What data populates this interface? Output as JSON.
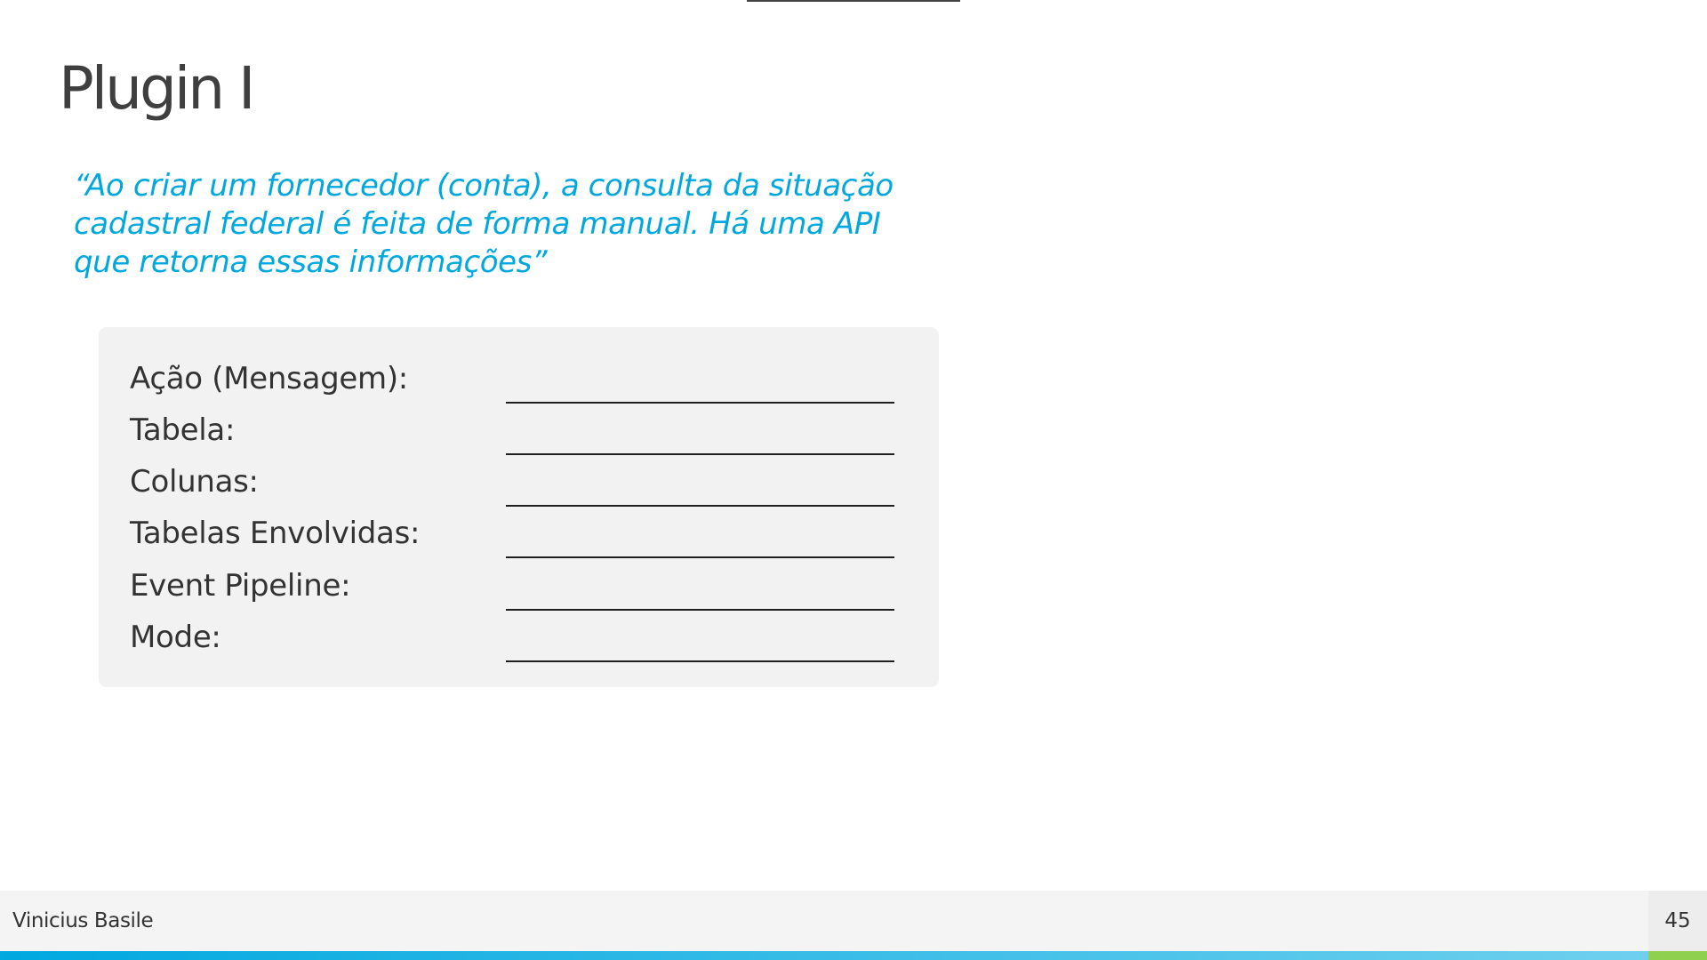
{
  "slide": {
    "title": "Plugin I",
    "quote": "“Ao criar um fornecedor (conta), a consulta da situação cadastral federal é feita de forma manual. Há uma API que retorna essas informações”",
    "form_fields": [
      {
        "label": "Ação (Mensagem):"
      },
      {
        "label": "Tabela:"
      },
      {
        "label": "Colunas:"
      },
      {
        "label": "Tabelas Envolvidas:"
      },
      {
        "label": "Event Pipeline:"
      },
      {
        "label": "Mode:"
      }
    ]
  },
  "footer": {
    "author": "Vinicius Basile",
    "page_number": "45"
  },
  "colors": {
    "quote": "#00a8de",
    "title": "#3f3f3f",
    "accent_bar": "#00a8e0",
    "accent_end": "#8fd14f"
  }
}
